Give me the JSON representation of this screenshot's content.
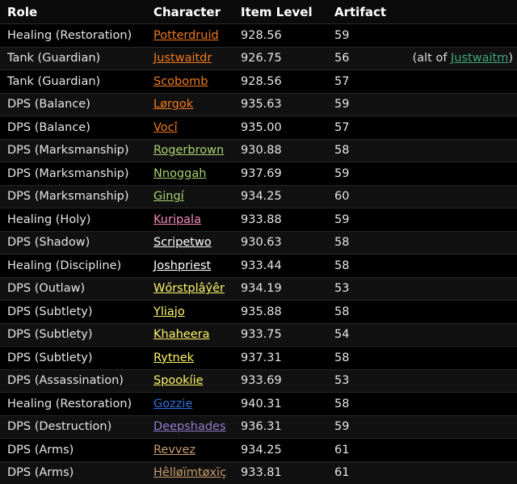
{
  "header": {
    "role": "Role",
    "character": "Character",
    "item_level": "Item Level",
    "artifact": "Artifact"
  },
  "colors": {
    "druid": "#ff7d0a",
    "hunter": "#abd473",
    "priest": "#ffffff",
    "paladin": "#f58cba",
    "rogue": "#fff569",
    "shaman": "#0070de",
    "warlock": "#9482c9",
    "warrior": "#c79c6e",
    "alt_link": "#3fa77f"
  },
  "rows": [
    {
      "role": "Healing (Restoration)",
      "character": "Potterdruid",
      "color": "#f07a1d",
      "ilvl": "928.56",
      "artifact": "59"
    },
    {
      "role": "Tank (Guardian)",
      "character": "Justwaitdr",
      "color": "#f07a1d",
      "ilvl": "926.75",
      "artifact": "56",
      "note_prefix": "(alt of ",
      "note_link": "Justwaitm",
      "note_suffix": ")"
    },
    {
      "role": "Tank (Guardian)",
      "character": "Scobomb",
      "color": "#f07a1d",
      "ilvl": "928.56",
      "artifact": "57"
    },
    {
      "role": "DPS (Balance)",
      "character": "Lørgok",
      "color": "#f07a1d",
      "ilvl": "935.63",
      "artifact": "59"
    },
    {
      "role": "DPS (Balance)",
      "character": "Vocî",
      "color": "#f07a1d",
      "ilvl": "935.00",
      "artifact": "57"
    },
    {
      "role": "DPS (Marksmanship)",
      "character": "Rogerbrown",
      "color": "#a9d271",
      "ilvl": "930.88",
      "artifact": "58"
    },
    {
      "role": "DPS (Marksmanship)",
      "character": "Nnoggah",
      "color": "#a9d271",
      "ilvl": "937.69",
      "artifact": "59"
    },
    {
      "role": "DPS (Marksmanship)",
      "character": "Gingí",
      "color": "#a9d271",
      "ilvl": "934.25",
      "artifact": "60"
    },
    {
      "role": "Healing (Holy)",
      "character": "Kuripala",
      "color": "#f58cba",
      "ilvl": "933.88",
      "artifact": "59"
    },
    {
      "role": "DPS (Shadow)",
      "character": "Scripetwo",
      "color": "#ffffff",
      "ilvl": "930.63",
      "artifact": "58"
    },
    {
      "role": "Healing (Discipline)",
      "character": "Joshpriest",
      "color": "#ffffff",
      "ilvl": "933.44",
      "artifact": "58"
    },
    {
      "role": "DPS (Outlaw)",
      "character": "Wőrstplâŷêr",
      "color": "#fff569",
      "ilvl": "934.19",
      "artifact": "53"
    },
    {
      "role": "DPS (Subtlety)",
      "character": "Yliajo",
      "color": "#fff569",
      "ilvl": "935.88",
      "artifact": "58"
    },
    {
      "role": "DPS (Subtlety)",
      "character": "Khaheera",
      "color": "#fff569",
      "ilvl": "933.75",
      "artifact": "54"
    },
    {
      "role": "DPS (Subtlety)",
      "character": "Rytnek",
      "color": "#fff569",
      "ilvl": "937.31",
      "artifact": "58"
    },
    {
      "role": "DPS (Assassination)",
      "character": "Spookíie",
      "color": "#fff569",
      "ilvl": "933.69",
      "artifact": "53"
    },
    {
      "role": "Healing (Restoration)",
      "character": "Gozzie",
      "color": "#2f6fe0",
      "ilvl": "940.31",
      "artifact": "58"
    },
    {
      "role": "DPS (Destruction)",
      "character": "Deepshades",
      "color": "#8f7fd0",
      "ilvl": "936.31",
      "artifact": "59"
    },
    {
      "role": "DPS (Arms)",
      "character": "Revvez",
      "color": "#c79c6e",
      "ilvl": "934.25",
      "artifact": "61"
    },
    {
      "role": "DPS (Arms)",
      "character": "Hêlløïmtøxïç",
      "color": "#c79c6e",
      "ilvl": "933.81",
      "artifact": "61"
    }
  ]
}
